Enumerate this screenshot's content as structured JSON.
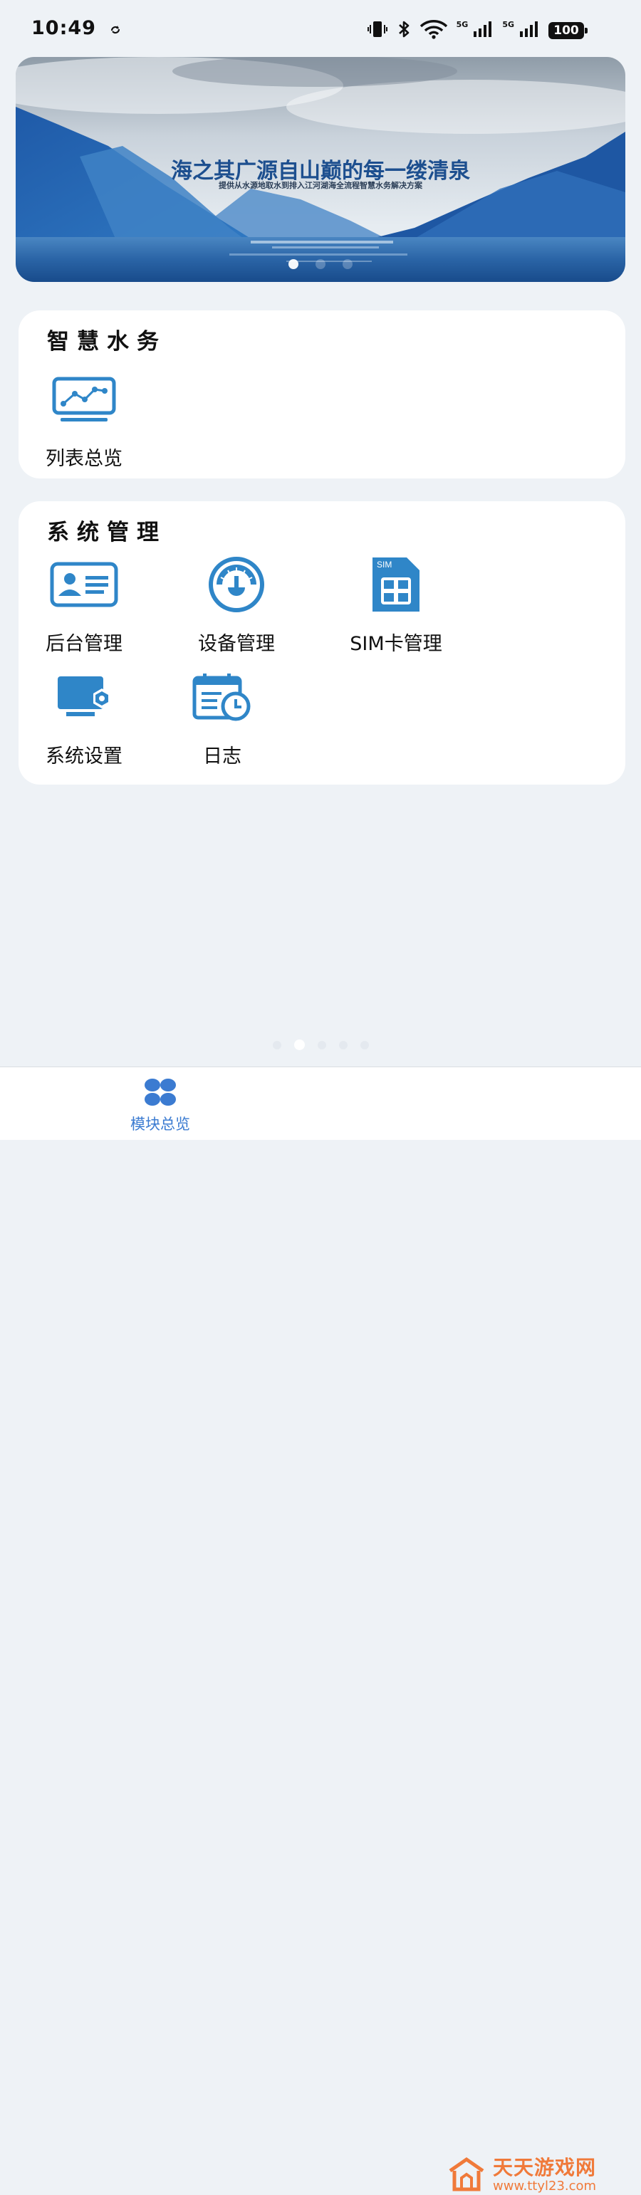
{
  "status_bar": {
    "time": "10:49",
    "network1": "5G",
    "network2": "5G",
    "battery": "100"
  },
  "banner": {
    "title": "海之其广源自山巅的每一缕清泉",
    "subtitle": "提供从水源地取水到排入江河湖海全流程智慧水务解决方案",
    "slide_count": 3,
    "active_slide": 1
  },
  "sections": [
    {
      "title": "智慧水务",
      "items": [
        {
          "label": "列表总览",
          "icon": "monitor-chart-icon"
        }
      ]
    },
    {
      "title": "系统管理",
      "items": [
        {
          "label": "后台管理",
          "icon": "id-card-icon"
        },
        {
          "label": "设备管理",
          "icon": "gauge-icon"
        },
        {
          "label": "SIM卡管理",
          "icon": "sim-card-icon"
        },
        {
          "label": "系统设置",
          "icon": "monitor-settings-icon"
        },
        {
          "label": "日志",
          "icon": "calendar-clock-icon"
        }
      ]
    }
  ],
  "pager": {
    "count": 5,
    "active": 2
  },
  "bottom_nav": {
    "tabs": [
      {
        "label": "模块总览",
        "icon": "four-petal-icon",
        "active": true
      }
    ]
  },
  "watermark": {
    "main": "天天游戏网",
    "sub": "www.ttyl23.com"
  },
  "colors": {
    "accent": "#3b7bd1",
    "icon_blue": "#2f86c8",
    "background": "#eef2f6"
  }
}
